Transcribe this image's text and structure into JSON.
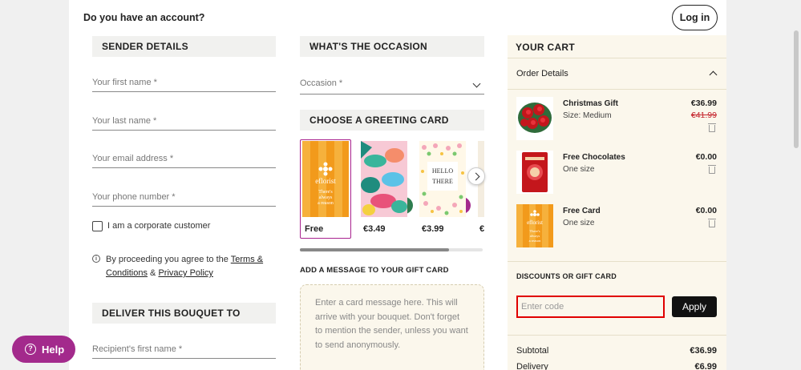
{
  "header": {
    "account_question": "Do you have an account?",
    "login_label": "Log in"
  },
  "sender": {
    "heading": "SENDER DETAILS",
    "first_name_placeholder": "Your first name *",
    "last_name_placeholder": "Your last name *",
    "email_placeholder": "Your email address *",
    "phone_placeholder": "Your phone number *",
    "corporate_label": "I am a corporate customer",
    "terms_prefix": "By proceeding you agree to the",
    "terms_link": "Terms & Conditions",
    "terms_and": "&",
    "privacy_link": "Privacy Policy"
  },
  "deliver": {
    "heading": "DELIVER THIS BOUQUET TO",
    "recipient_first_placeholder": "Recipient's first name *"
  },
  "occasion": {
    "heading": "WHAT'S THE OCCASION",
    "select_placeholder": "Occasion *"
  },
  "greeting": {
    "heading": "CHOOSE A GREETING CARD",
    "cards": [
      {
        "price": "Free",
        "selected": true,
        "card_text": "eflorist"
      },
      {
        "price": "€3.49",
        "selected": false
      },
      {
        "price": "€3.99",
        "selected": false,
        "card_text": "HELLO THERE"
      },
      {
        "price": "€"
      }
    ]
  },
  "message": {
    "heading": "ADD A MESSAGE TO YOUR GIFT CARD",
    "placeholder": "Enter a card message here. This will arrive with your bouquet. Don't forget to mention the sender, unless you want to send anonymously."
  },
  "cart": {
    "heading": "YOUR CART",
    "order_details": "Order Details",
    "items": [
      {
        "name": "Christmas Gift",
        "sub": "Size: Medium",
        "price": "€36.99",
        "old_price": "€41.99"
      },
      {
        "name": "Free Chocolates",
        "sub": "One size",
        "price": "€0.00"
      },
      {
        "name": "Free Card",
        "sub": "One size",
        "price": "€0.00"
      }
    ],
    "discount_heading": "DISCOUNTS OR GIFT CARD",
    "code_placeholder": "Enter code",
    "apply_label": "Apply",
    "subtotal_label": "Subtotal",
    "subtotal_value": "€36.99",
    "delivery_label": "Delivery",
    "delivery_value": "€6.99"
  },
  "help": {
    "label": "Help"
  },
  "colors": {
    "brand_purple": "#a32a8c",
    "cart_bg": "#fbf7ec",
    "highlight_red": "#e00000"
  }
}
